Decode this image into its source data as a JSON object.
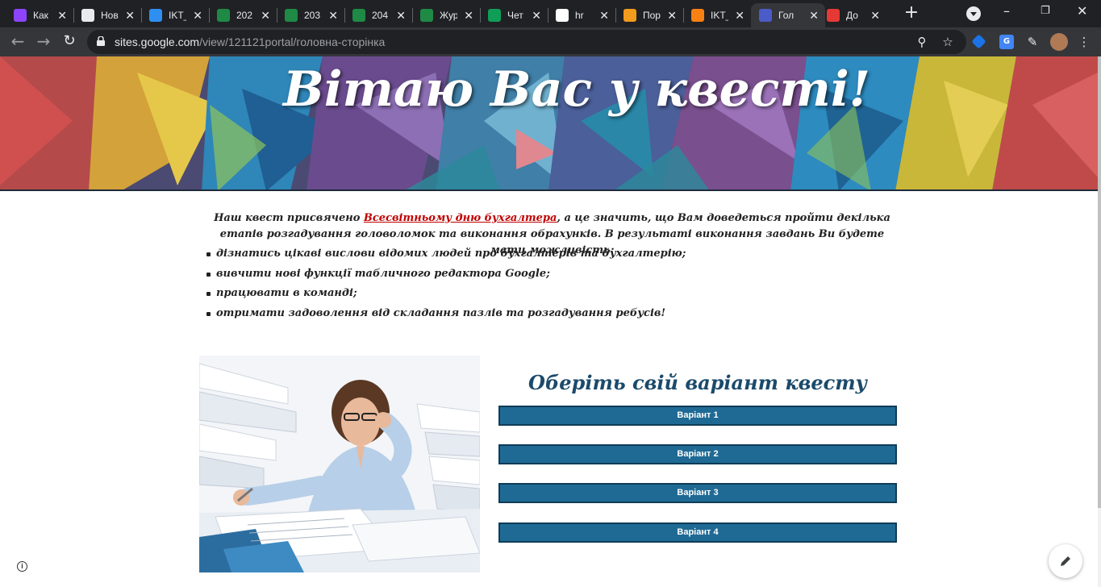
{
  "browser": {
    "tabs": [
      {
        "title": "Как",
        "icon": "app-icon",
        "color": "#8e44ff"
      },
      {
        "title": "Нов",
        "icon": "chrome-icon",
        "color": "#e8eaed"
      },
      {
        "title": "IKT_",
        "icon": "onedrive-icon",
        "color": "#2f8ff0"
      },
      {
        "title": "202",
        "icon": "excel-icon",
        "color": "#1f8a45"
      },
      {
        "title": "203",
        "icon": "excel-icon",
        "color": "#1f8a45"
      },
      {
        "title": "204",
        "icon": "excel-icon",
        "color": "#1f8a45"
      },
      {
        "title": "Жур",
        "icon": "excel-icon",
        "color": "#1f8a45"
      },
      {
        "title": "Чет",
        "icon": "sheets-icon",
        "color": "#0f9d58"
      },
      {
        "title": "hr",
        "icon": "google-icon",
        "color": "#ffffff"
      },
      {
        "title": "Пор",
        "icon": "site-icon",
        "color": "#f29b1d"
      },
      {
        "title": "IKT_",
        "icon": "moodle-icon",
        "color": "#f98012"
      },
      {
        "title": "Гол",
        "icon": "google-sites-icon",
        "color": "#4a5cc7",
        "active": true
      },
      {
        "title": "До",
        "icon": "target-icon",
        "color": "#e53935"
      }
    ],
    "url_host": "sites.google.com",
    "url_path": "/view/121121portal/головна-сторінка"
  },
  "hero": {
    "title": "Вітаю Вас у квесті!"
  },
  "intro": {
    "before_link": "Наш квест присвячено ",
    "link_text": "Всесвітньому дню бухгалтера",
    "after_link": ", а це значить, що Вам доведеться пройти декілька етапів розгадування головоломок та виконання обрахунків. В результаті виконання завдань Ви будете мати можливість:"
  },
  "bullets": [
    "дізнатись цікаві вислови відомих людей про бухгалтерів та бухгалтерію;",
    "вивчити нові функції табличного редактора Google;",
    "працювати в команді;",
    "отримати задоволення від складання пазлів та розгадування ребусів!"
  ],
  "variants": {
    "heading": "Оберіть свій варіант квесту",
    "buttons": [
      "Варіант 1",
      "Варіант 2",
      "Варіант 3",
      "Варіант 4"
    ]
  },
  "colors": {
    "button_bg": "#1f6a94",
    "heading": "#1b4a6b",
    "link": "#c00000"
  }
}
